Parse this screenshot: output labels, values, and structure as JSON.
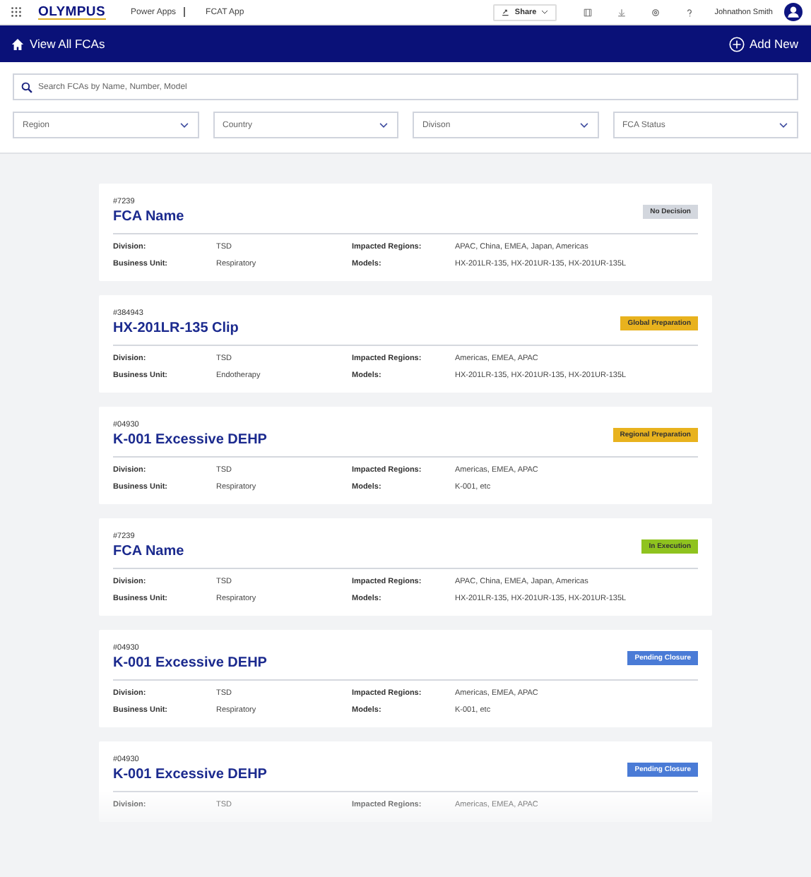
{
  "topbar": {
    "logo": "OLYMPUS",
    "app_path": [
      "Power Apps",
      "FCAT App"
    ],
    "share": "Share",
    "user": "Johnathon Smith"
  },
  "navbar": {
    "title": "View All FCAs",
    "add": "Add New"
  },
  "search": {
    "placeholder": "Search FCAs by Name, Number, Model"
  },
  "filters": [
    {
      "placeholder": "Region"
    },
    {
      "placeholder": "Country"
    },
    {
      "placeholder": "Divison"
    },
    {
      "placeholder": "FCA Status"
    }
  ],
  "cards": [
    {
      "number": "#7239",
      "name": "FCA Name",
      "status": "No Decision",
      "color": "#d3d7de",
      "fields": [
        [
          "Division:",
          "TSD",
          "Impacted Regions:",
          "APAC, China, EMEA, Japan, Americas"
        ],
        [
          "Business Unit:",
          "Respiratory",
          "Models:",
          "HX-201LR-135, HX-201UR-135, HX-201UR-135L"
        ]
      ]
    },
    {
      "number": "#384943",
      "name": "HX-201LR-135 Clip",
      "status": "Global Preparation",
      "color": "#e8b21e",
      "fields": [
        [
          "Division:",
          "TSD",
          "Impacted Regions:",
          "Americas, EMEA, APAC"
        ],
        [
          "Business Unit:",
          "Endotherapy",
          "Models:",
          "HX-201LR-135, HX-201UR-135, HX-201UR-135L"
        ]
      ]
    },
    {
      "number": "#04930",
      "name": "K-001 Excessive DEHP",
      "status": "Regional Preparation",
      "color": "#e8b21e",
      "fields": [
        [
          "Division:",
          "TSD",
          "Impacted Regions:",
          "Americas, EMEA, APAC"
        ],
        [
          "Business Unit:",
          "Respiratory",
          "Models:",
          "K-001, etc"
        ]
      ]
    },
    {
      "number": "#7239",
      "name": "FCA Name",
      "status": "In Execution",
      "color": "#8fc31f",
      "fields": [
        [
          "Division:",
          "TSD",
          "Impacted Regions:",
          "APAC, China, EMEA, Japan, Americas"
        ],
        [
          "Business Unit:",
          "Respiratory",
          "Models:",
          "HX-201LR-135, HX-201UR-135, HX-201UR-135L"
        ]
      ]
    },
    {
      "number": "#04930",
      "name": "K-001 Excessive DEHP",
      "status": "Pending Closure",
      "color": "#4a7bd6",
      "fields": [
        [
          "Division:",
          "TSD",
          "Impacted Regions:",
          "Americas, EMEA, APAC"
        ],
        [
          "Business Unit:",
          "Respiratory",
          "Models:",
          "K-001, etc"
        ]
      ]
    },
    {
      "number": "#04930",
      "name": "K-001 Excessive DEHP",
      "status": "Pending Closure",
      "color": "#4a7bd6",
      "fields": [
        [
          "Division:",
          "TSD",
          "Impacted Regions:",
          "Americas, EMEA, APAC"
        ]
      ]
    }
  ]
}
